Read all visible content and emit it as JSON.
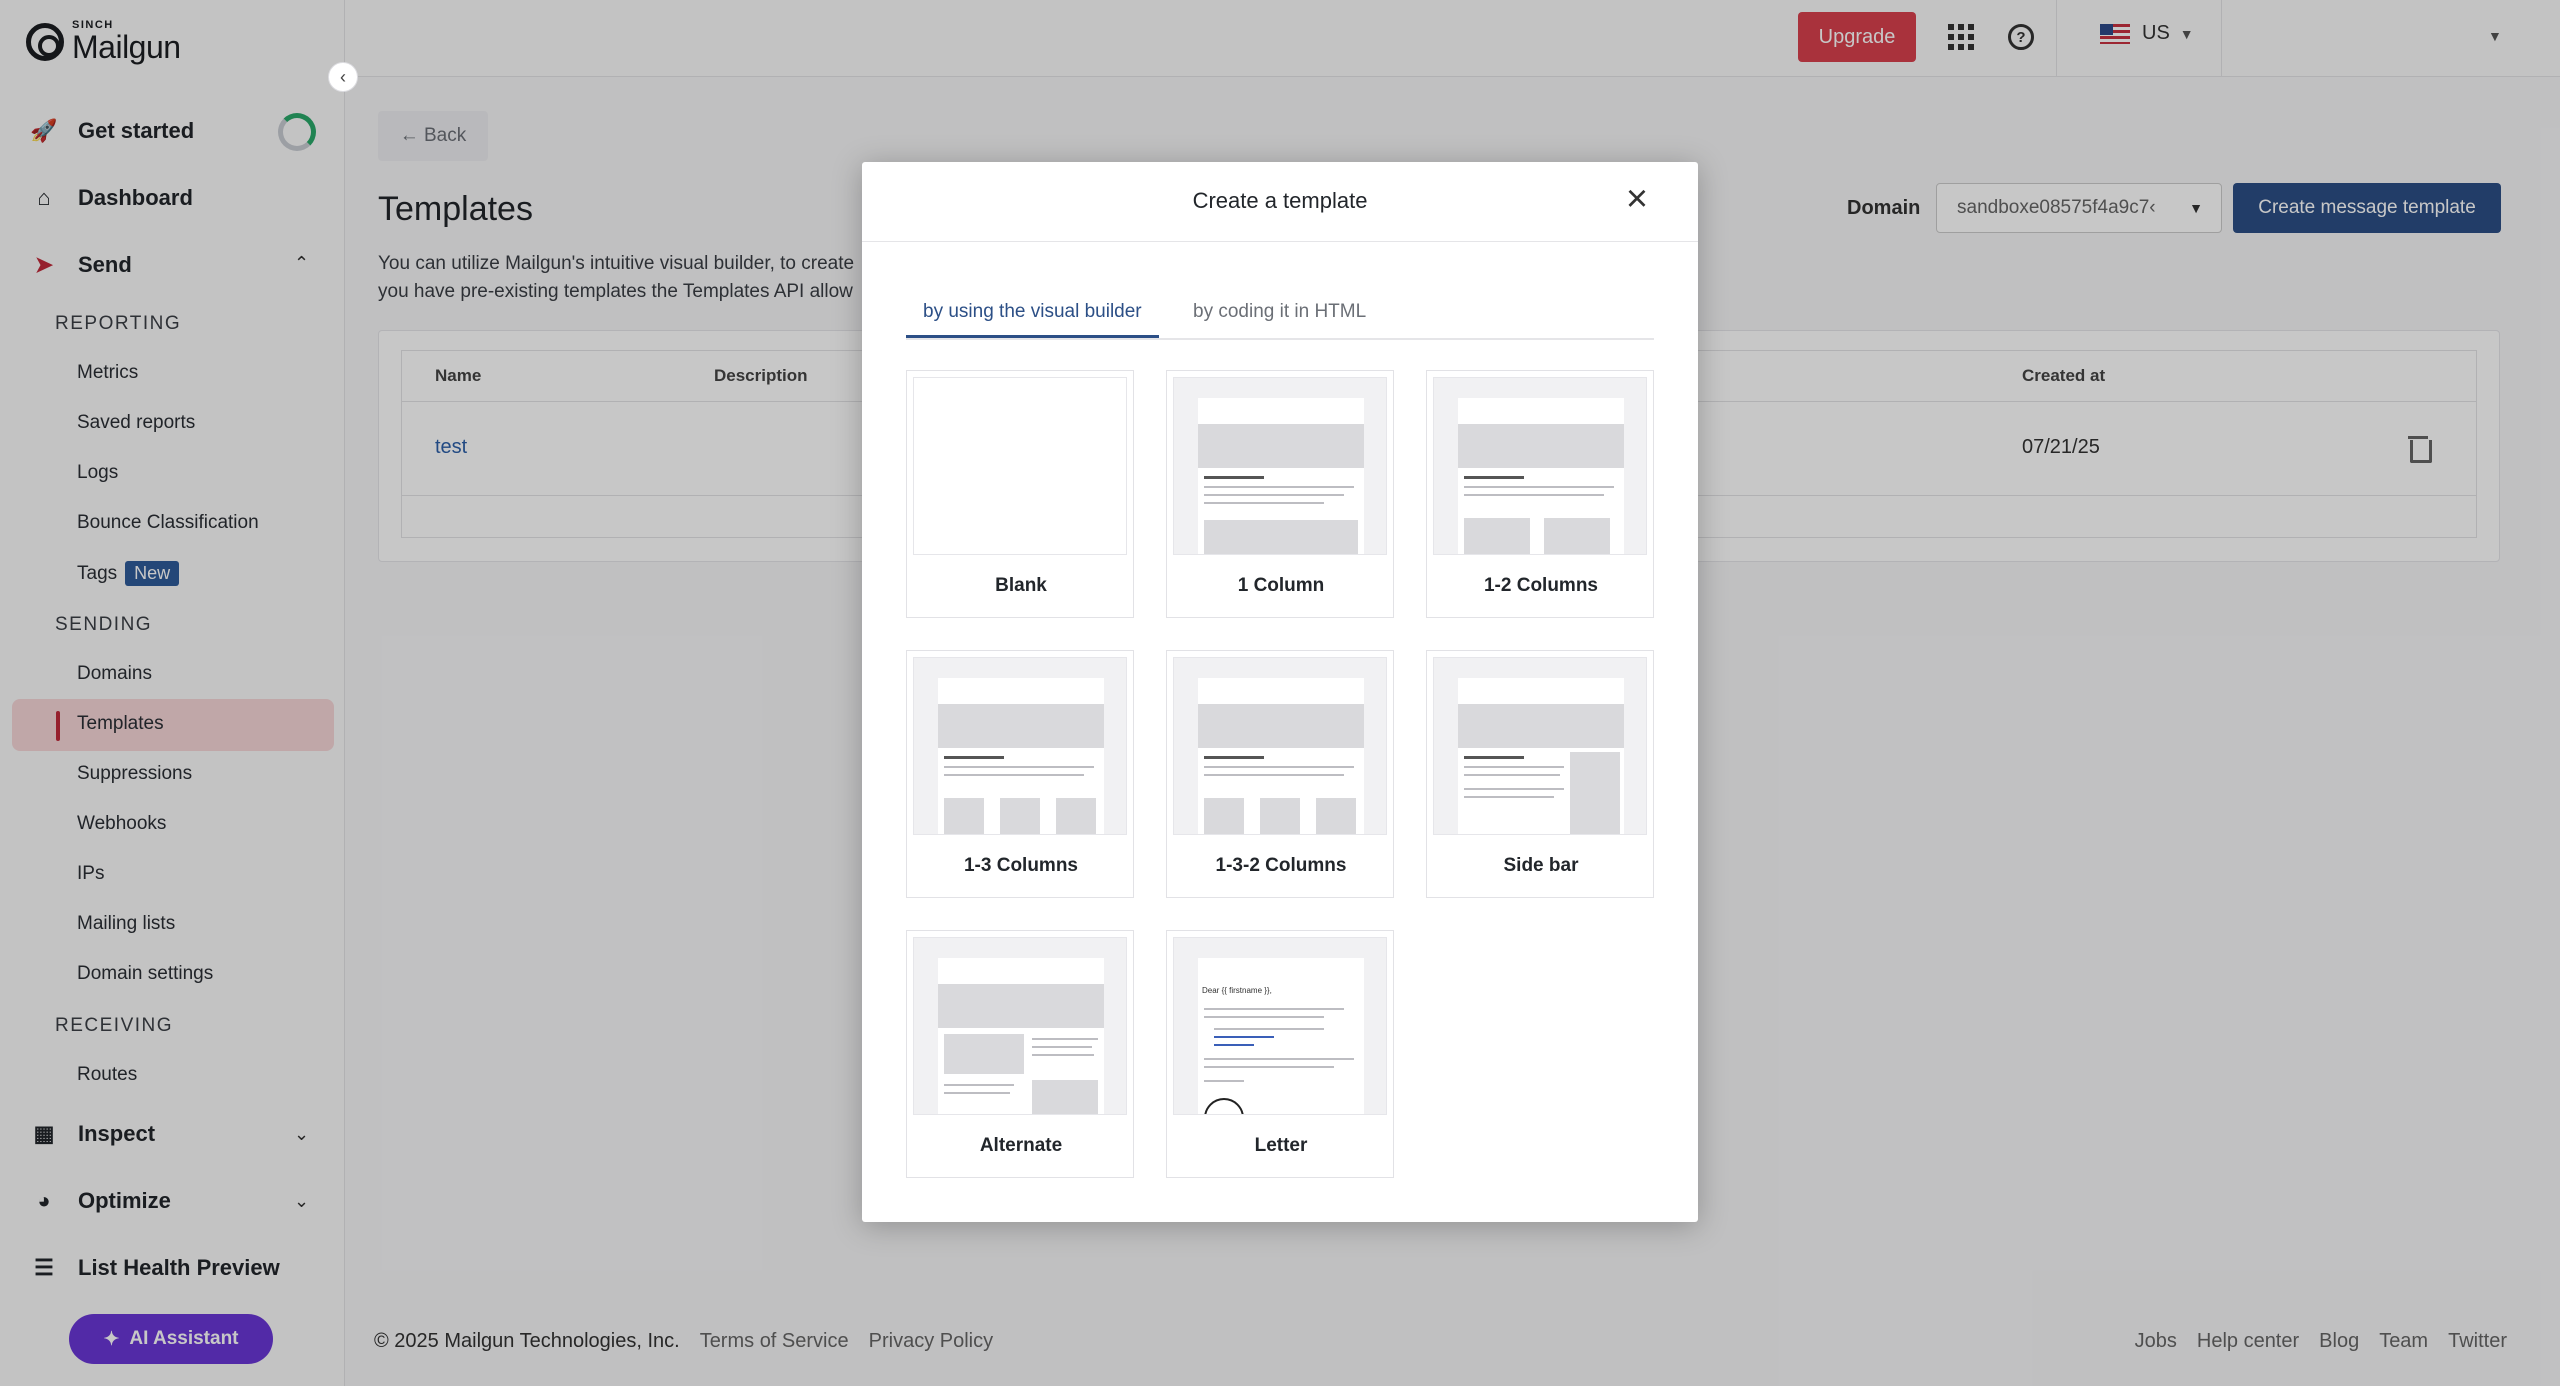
{
  "brand": {
    "sinch": "SINCH",
    "name": "Mailgun"
  },
  "sidebar": {
    "top_items": [
      {
        "label": "Get started",
        "icon": "rocket-icon"
      },
      {
        "label": "Dashboard",
        "icon": "home-icon"
      },
      {
        "label": "Send",
        "icon": "send-icon"
      }
    ],
    "sections": {
      "reporting": "REPORTING",
      "sending": "SENDING",
      "receiving": "RECEIVING"
    },
    "reporting_items": [
      "Metrics",
      "Saved reports",
      "Logs",
      "Bounce Classification",
      "Tags"
    ],
    "tags_badge": "New",
    "sending_items": [
      "Domains",
      "Templates",
      "Suppressions",
      "Webhooks",
      "IPs",
      "Mailing lists",
      "Domain settings"
    ],
    "receiving_items": [
      "Routes"
    ],
    "bottom_items": [
      {
        "label": "Inspect",
        "icon": "inspect-icon"
      },
      {
        "label": "Optimize",
        "icon": "optimize-icon"
      },
      {
        "label": "List Health Preview",
        "icon": "list-health-icon"
      }
    ],
    "ai_assistant": "AI Assistant"
  },
  "topbar": {
    "upgrade": "Upgrade",
    "region": "US"
  },
  "main": {
    "back": "← Back",
    "title": "Templates",
    "description_line1": "You can utilize Mailgun's intuitive visual builder, to create",
    "description_line2": "you have pre-existing templates the Templates API allow",
    "domain_label": "Domain",
    "domain_value": "sandboxe08575f4a9c7‹",
    "create_button": "Create message template",
    "table": {
      "headers": {
        "name": "Name",
        "description": "Description",
        "created_at": "Created at"
      },
      "rows": [
        {
          "name": "test",
          "created_at": "07/21/25"
        }
      ]
    }
  },
  "footer": {
    "copyright": "© 2025 Mailgun Technologies, Inc.",
    "left_links": [
      "Terms of Service",
      "Privacy Policy"
    ],
    "right_links": [
      "Jobs",
      "Help center",
      "Blog",
      "Team",
      "Twitter"
    ]
  },
  "modal": {
    "title": "Create a template",
    "tabs": [
      "by using the visual builder",
      "by coding it in HTML"
    ],
    "active_tab": 0,
    "templates": [
      "Blank",
      "1 Column",
      "1-2 Columns",
      "1-3 Columns",
      "1-3-2 Columns",
      "Side bar",
      "Alternate",
      "Letter"
    ],
    "thumb_title": "Title of your email",
    "letter_greeting": "Dear {{ firstname }},"
  },
  "colors": {
    "accent": "#2c4f86",
    "upgrade": "#d9404d",
    "active_nav": "#f6d6d8",
    "ai": "#6a36d6"
  }
}
